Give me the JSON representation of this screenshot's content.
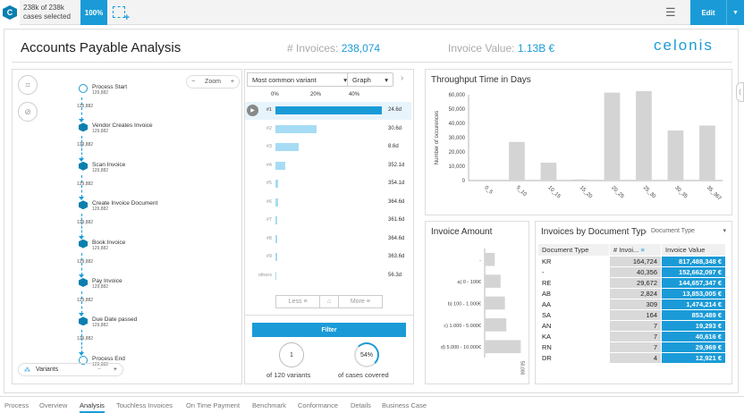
{
  "topbar": {
    "logo_letter": "C",
    "cases_count": "238k of 238k",
    "cases_label": "cases selected",
    "percent": "100%",
    "edit_label": "Edit"
  },
  "header": {
    "title": "Accounts Payable Analysis",
    "invoices_label": "# Invoices:",
    "invoices_value": "238,074",
    "value_label": "Invoice Value:",
    "value_value": "1.13B €",
    "brand": "celonis"
  },
  "process": {
    "zoom_label": "Zoom",
    "variants_label": "Variants",
    "nodes": [
      {
        "name": "Process Start",
        "count": "129,882"
      },
      {
        "name": "Vendor Creates Invoice",
        "count": "129,882"
      },
      {
        "name": "Scan Invoice",
        "count": "129,882"
      },
      {
        "name": "Create Invoice Document",
        "count": "129,882"
      },
      {
        "name": "Book Invoice",
        "count": "129,882"
      },
      {
        "name": "Pay Invoice",
        "count": "129,882"
      },
      {
        "name": "Due Date passed",
        "count": "129,882"
      },
      {
        "name": "Process End",
        "count": "129,882"
      }
    ],
    "edge_count": "129,882"
  },
  "variants": {
    "selector": "Most common variant",
    "graph_label": "Graph",
    "axis_ticks": [
      "0%",
      "20%",
      "40%"
    ],
    "rows": [
      {
        "label": "#1",
        "pct": 54,
        "value": "24.6d"
      },
      {
        "label": "#2",
        "pct": 21,
        "value": "30.6d"
      },
      {
        "label": "#3",
        "pct": 12,
        "value": "8.6d"
      },
      {
        "label": "#4",
        "pct": 5,
        "value": "352.1d"
      },
      {
        "label": "#5",
        "pct": 1.5,
        "value": "354.1d"
      },
      {
        "label": "#6",
        "pct": 1.2,
        "value": "364.6d"
      },
      {
        "label": "#7",
        "pct": 1,
        "value": "361.6d"
      },
      {
        "label": "#8",
        "pct": 0.8,
        "value": "364.6d"
      },
      {
        "label": "#9",
        "pct": 0.7,
        "value": "363.6d"
      },
      {
        "label": "others",
        "pct": 0.6,
        "value": "56.3d"
      }
    ],
    "less_label": "Less",
    "more_label": "More",
    "filter_label": "Filter",
    "variants_count": "1",
    "variants_caption": "of 120 variants",
    "cases_pct": "54%",
    "cases_caption": "of cases covered"
  },
  "throughput": {
    "title": "Throughput Time in Days",
    "chart_data": {
      "type": "bar",
      "categories": [
        "0_5",
        "5_10",
        "10_15",
        "15_20",
        "20_25",
        "25_30",
        "30_35",
        "35_367"
      ],
      "values": [
        0,
        27000,
        12500,
        800,
        61500,
        62500,
        35000,
        38500
      ],
      "ylabel": "Number of occurences",
      "ylim": [
        0,
        60000
      ],
      "yticks": [
        "0",
        "10,000",
        "20,000",
        "30,000",
        "40,000",
        "50,000",
        "60,000"
      ]
    }
  },
  "amount": {
    "title": "Invoice Amount",
    "chart_data": {
      "type": "bar",
      "categories": [
        "-",
        "a) 0 - 100€",
        "b) 100 - 1.000€",
        "c) 1.000 - 5.000€",
        "d) 5.000 - 10.000€"
      ],
      "values": [
        14000,
        22000,
        28000,
        30000,
        50000
      ],
      "xtick": "50,000"
    }
  },
  "doctype": {
    "title": "Invoices by Document Type",
    "dropdown": "Document Type",
    "columns": [
      "Document Type",
      "# Invoi...",
      "Invoice Value"
    ],
    "rows": [
      {
        "type": "KR",
        "count": "164,724",
        "value": "817,488,348 €"
      },
      {
        "type": "-",
        "count": "40,356",
        "value": "152,662,097 €"
      },
      {
        "type": "RE",
        "count": "29,672",
        "value": "144,657,347 €"
      },
      {
        "type": "AB",
        "count": "2,824",
        "value": "13,853,005 €"
      },
      {
        "type": "AA",
        "count": "309",
        "value": "1,474,214 €"
      },
      {
        "type": "SA",
        "count": "164",
        "value": "853,489 €"
      },
      {
        "type": "AN",
        "count": "7",
        "value": "19,293 €"
      },
      {
        "type": "KA",
        "count": "7",
        "value": "40,616 €"
      },
      {
        "type": "RN",
        "count": "7",
        "value": "29,969 €"
      },
      {
        "type": "DR",
        "count": "4",
        "value": "12,921 €"
      }
    ]
  },
  "tabs": [
    "Process",
    "Overview",
    "Analysis",
    "Touchless Invoices",
    "On Time Payment",
    "Benchmark",
    "Conformance",
    "Details",
    "Business Case"
  ],
  "active_tab": "Analysis"
}
